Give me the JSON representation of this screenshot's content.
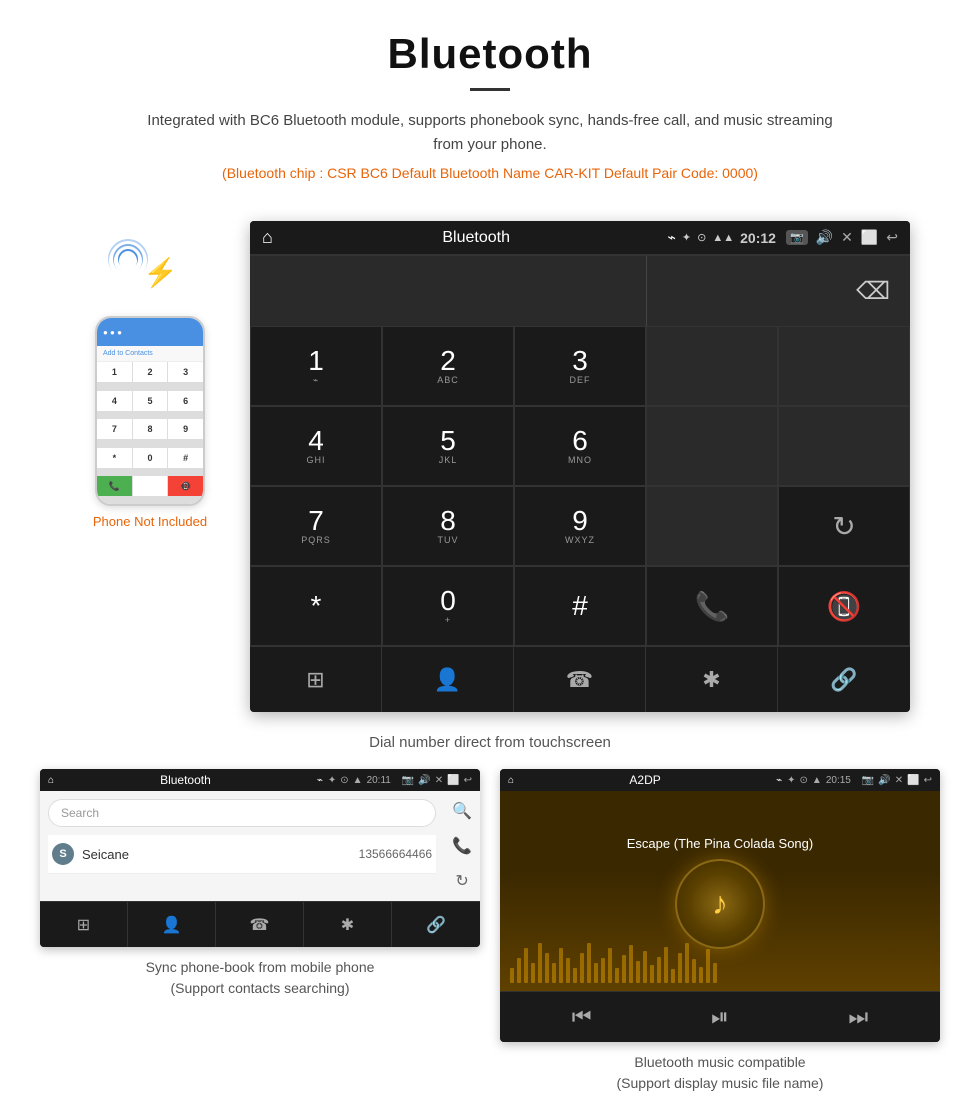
{
  "header": {
    "title": "Bluetooth",
    "description": "Integrated with BC6 Bluetooth module, supports phonebook sync, hands-free call, and music streaming from your phone.",
    "specs": "(Bluetooth chip : CSR BC6    Default Bluetooth Name CAR-KIT    Default Pair Code: 0000)"
  },
  "main_display": {
    "status_bar": {
      "home_icon": "⌂",
      "title": "Bluetooth",
      "usb_icon": "⌁",
      "time": "20:12",
      "bt_icon": "✦",
      "gps_icon": "⊙",
      "signal_icon": "▲",
      "camera_icon": "📷",
      "volume_icon": "♪",
      "close_icon": "✕",
      "screen_icon": "⬜",
      "back_icon": "↩"
    },
    "dialpad": {
      "rows": [
        [
          {
            "main": "1",
            "sub": "⌁"
          },
          {
            "main": "2",
            "sub": "ABC"
          },
          {
            "main": "3",
            "sub": "DEF"
          }
        ],
        [
          {
            "main": "4",
            "sub": "GHI"
          },
          {
            "main": "5",
            "sub": "JKL"
          },
          {
            "main": "6",
            "sub": "MNO"
          }
        ],
        [
          {
            "main": "7",
            "sub": "PQRS"
          },
          {
            "main": "8",
            "sub": "TUV"
          },
          {
            "main": "9",
            "sub": "WXYZ"
          }
        ],
        [
          {
            "main": "*",
            "sub": ""
          },
          {
            "main": "0",
            "sub": "+"
          },
          {
            "main": "#",
            "sub": ""
          }
        ]
      ]
    },
    "bottom_nav": [
      "⊞",
      "👤",
      "☎",
      "✱",
      "🔗"
    ]
  },
  "phone_widget": {
    "not_included_text": "Phone Not Included",
    "screen_label": "Add to Contacts",
    "keypad_keys": [
      "1",
      "2",
      "3",
      "4",
      "5",
      "6",
      "7",
      "8",
      "9",
      "*",
      "0",
      "#"
    ]
  },
  "dial_caption": "Dial number direct from touchscreen",
  "bottom_left": {
    "status_title": "Bluetooth",
    "time": "20:11",
    "search_placeholder": "Search",
    "entry": {
      "letter": "S",
      "name": "Seicane",
      "number": "13566664466"
    },
    "caption_line1": "Sync phone-book from mobile phone",
    "caption_line2": "(Support contacts searching)"
  },
  "bottom_right": {
    "status_title": "A2DP",
    "time": "20:15",
    "song_title": "Escape (The Pina Colada Song)",
    "caption_line1": "Bluetooth music compatible",
    "caption_line2": "(Support display music file name)"
  },
  "eq_heights": [
    15,
    25,
    35,
    20,
    40,
    30,
    20,
    35,
    25,
    15,
    30,
    40,
    20,
    25,
    35,
    15,
    28,
    38,
    22,
    32,
    18,
    26,
    36,
    14,
    30,
    40,
    24,
    16,
    34,
    20
  ]
}
